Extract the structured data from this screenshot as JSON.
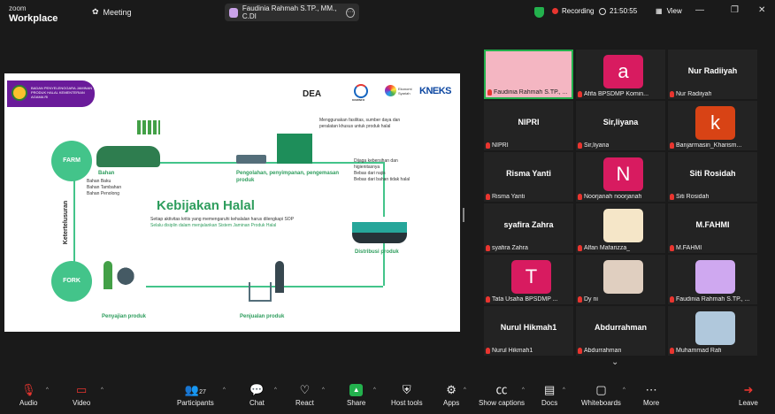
{
  "topbar": {
    "logo_line1": "zoom",
    "logo_line2": "Workplace",
    "meeting_label": "Meeting",
    "host_name": "Faudinia Rahmah S.TP., MM., C.DI",
    "recording_label": "Recording",
    "time": "21:50:55",
    "view_label": "View",
    "minimize": "—",
    "restore": "❐",
    "close": "✕"
  },
  "slide": {
    "banner_text": "BADAN PENYELENGGARA JAMINAN PRODUK HALAL KEMENTERIAN AGAMA RI",
    "dea_label": "DEA",
    "kominfo_label": "KOMINFO",
    "kneks_small": "Ekonomi Syariah",
    "kneks_big": "KNEKS",
    "farm": "FARM",
    "fork": "FORK",
    "ketertelusuran": "Ketertelusuran",
    "bahan_title": "Bahan",
    "bahan_items": [
      "Bahan Baku",
      "Bahan Tambahan",
      "Bahan Penolong"
    ],
    "pengolahan_title": "Pengolahan, penyimpanan, pengemasan produk",
    "fasilitas_text": "Menggunakan fasilitas, sumber daya dan peralatan khusus untuk produk halal",
    "dijaga_items": [
      "Dijaga kebersihan dan higienitasnya",
      "Bebas dari najis",
      "Bebas dari bahan tidak halal"
    ],
    "kebijakan_title": "Kebijakan Halal",
    "kebijakan_items": [
      "Setiap aktivitas kritis yang memengaruhi kehalalan harus dilengkapi SOP",
      "Selalu disiplin dalam menjalankan Sistem Jaminan Produk Halal"
    ],
    "distribusi": "Distribusi produk",
    "penyajian": "Penyajian produk",
    "penjualan": "Penjualan produk"
  },
  "gallery": {
    "speaker_caption": "Faudinia Rahmah S.TP., ...",
    "tiles": [
      {
        "name": "",
        "caption": "Faudinia Rahmah S.TP., ...",
        "avatar": "",
        "color": "#f4b6c2"
      },
      {
        "name": "",
        "caption": "Afifa BPSDMP Komin...",
        "avatar": "a",
        "color": "#d81b60"
      },
      {
        "name": "Nur Radiiyah",
        "caption": "Nur Radiiyah",
        "avatar": "",
        "color": ""
      },
      {
        "name": "NIPRI",
        "caption": "NIPRI",
        "avatar": "",
        "color": ""
      },
      {
        "name": "Sir,liyana",
        "caption": "Sir,liyana",
        "avatar": "",
        "color": ""
      },
      {
        "name": "",
        "caption": "Banjarmasin_Kharism...",
        "avatar": "k",
        "color": "#d84315"
      },
      {
        "name": "Risma Yanti",
        "caption": "Risma Yanti",
        "avatar": "",
        "color": ""
      },
      {
        "name": "",
        "caption": "Noorjanah noorjanah",
        "avatar": "N",
        "color": "#d81b60"
      },
      {
        "name": "Siti Rosidah",
        "caption": "Siti Rosidah",
        "avatar": "",
        "color": ""
      },
      {
        "name": "syafira Zahra",
        "caption": "syafira Zahra",
        "avatar": "",
        "color": ""
      },
      {
        "name": "",
        "caption": "Alfan Mafarizza_",
        "avatar": "",
        "color": "#f5e6c8"
      },
      {
        "name": "M.FAHMI",
        "caption": "M.FAHMI",
        "avatar": "",
        "color": ""
      },
      {
        "name": "",
        "caption": "Tata Usaha BPSDMP ...",
        "avatar": "T",
        "color": "#d81b60"
      },
      {
        "name": "",
        "caption": "Dy ni",
        "avatar": "",
        "color": "#e0cfc0"
      },
      {
        "name": "",
        "caption": "Faudinia Rahmah S.TP., ...",
        "avatar": "",
        "color": "#cfa8f0"
      },
      {
        "name": "Nurul Hikmah1",
        "caption": "Nurul Hikmah1",
        "avatar": "",
        "color": ""
      },
      {
        "name": "Abdurrahman",
        "caption": "Abdurrahman",
        "avatar": "",
        "color": ""
      },
      {
        "name": "",
        "caption": "Muhammad Rafi",
        "avatar": "",
        "color": "#b0c8dc"
      }
    ]
  },
  "toolbar": {
    "audio": "Audio",
    "video": "Video",
    "participants": "Participants",
    "participants_count": "27",
    "chat": "Chat",
    "react": "React",
    "share": "Share",
    "host_tools": "Host tools",
    "apps": "Apps",
    "captions": "Show captions",
    "docs": "Docs",
    "whiteboards": "Whiteboards",
    "more": "More",
    "leave": "Leave"
  }
}
